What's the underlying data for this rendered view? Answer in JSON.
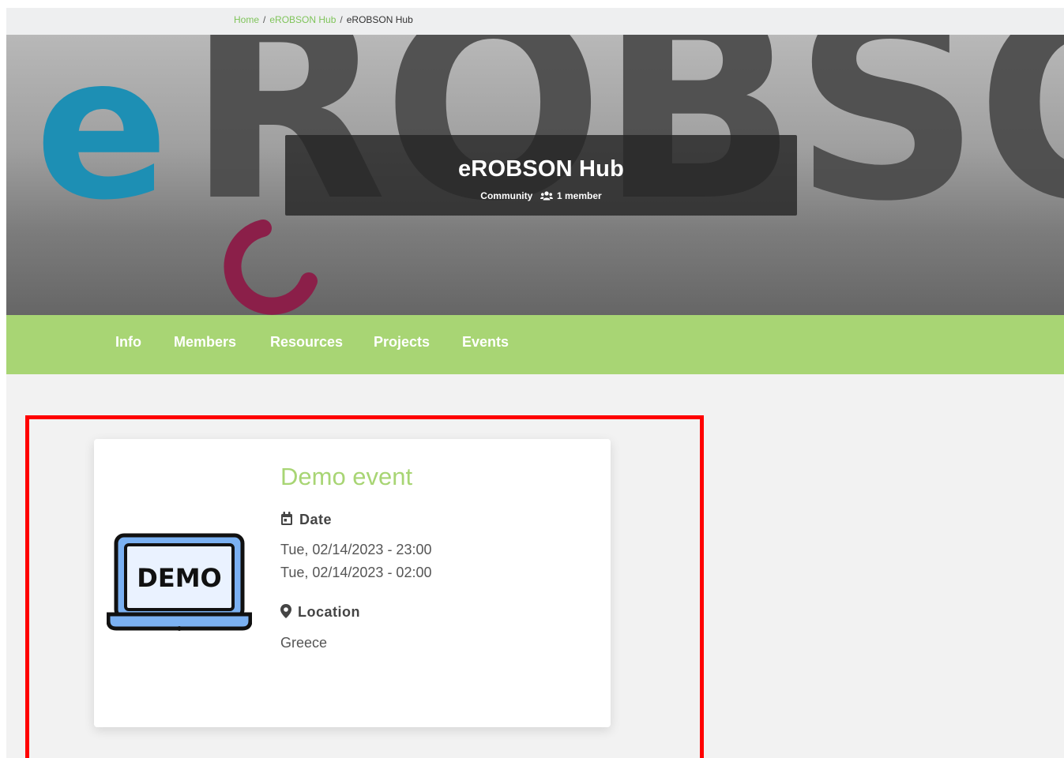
{
  "breadcrumb": {
    "items": [
      {
        "label": "Home",
        "link": true
      },
      {
        "label": "eROBSON Hub",
        "link": true
      },
      {
        "label": "eROBSON Hub",
        "link": false
      }
    ],
    "separator": "/"
  },
  "hero": {
    "background_text": "eROBSO",
    "title": "eROBSON Hub",
    "type": "Community",
    "member_count": "1 member",
    "icon": "users-icon"
  },
  "nav": {
    "items": [
      "Info",
      "Members",
      "Resources",
      "Projects",
      "Events"
    ],
    "background_color": "#a8d574"
  },
  "event": {
    "title": "Demo event",
    "image_text": "DEMO",
    "image_icon": "demo-laptop-icon",
    "date_label": "Date",
    "date_icon": "calendar-icon",
    "start": "Tue, 02/14/2023 - 23:00",
    "end": "Tue, 02/14/2023 - 02:00",
    "location_label": "Location",
    "location_icon": "map-marker-icon",
    "location": "Greece",
    "title_color": "#a8d574"
  },
  "highlight_color": "#ff0000"
}
